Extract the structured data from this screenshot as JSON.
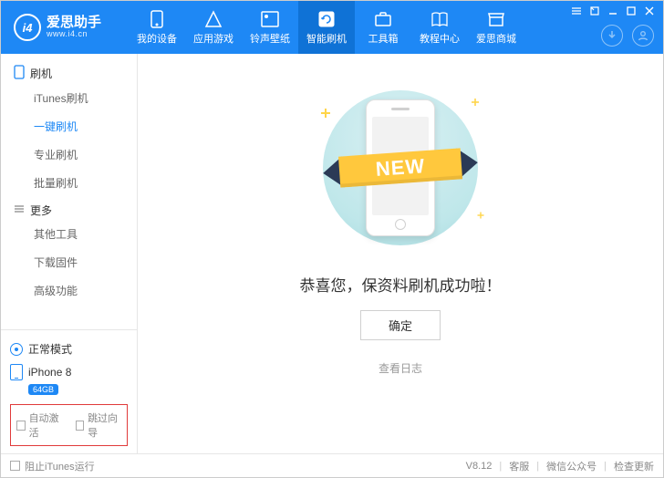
{
  "brand": {
    "cn": "爱思助手",
    "url": "www.i4.cn",
    "logo_text": "i4"
  },
  "nav": [
    {
      "label": "我的设备"
    },
    {
      "label": "应用游戏"
    },
    {
      "label": "铃声壁纸"
    },
    {
      "label": "智能刷机"
    },
    {
      "label": "工具箱"
    },
    {
      "label": "教程中心"
    },
    {
      "label": "爱思商城"
    }
  ],
  "sidebar": {
    "group1": {
      "title": "刷机",
      "items": [
        "iTunes刷机",
        "一键刷机",
        "专业刷机",
        "批量刷机"
      ]
    },
    "group2": {
      "title": "更多",
      "items": [
        "其他工具",
        "下载固件",
        "高级功能"
      ]
    },
    "mode": "正常模式",
    "device": {
      "name": "iPhone 8",
      "storage": "64GB"
    },
    "checkboxes": {
      "auto_activate": "自动激活",
      "skip_guide": "跳过向导"
    }
  },
  "main": {
    "ribbon": "NEW",
    "success_text": "恭喜您，保资料刷机成功啦！",
    "confirm": "确定",
    "view_log": "查看日志"
  },
  "footer": {
    "block_itunes": "阻止iTunes运行",
    "version": "V8.12",
    "links": [
      "客服",
      "微信公众号",
      "检查更新"
    ]
  }
}
